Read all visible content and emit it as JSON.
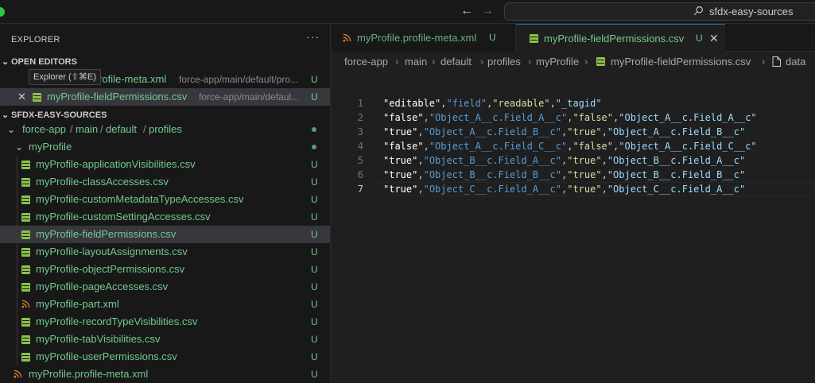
{
  "titlebar": {
    "back_icon": "arrow-left-icon",
    "forward_icon": "arrow-right-icon",
    "search_text": "sfdx-easy-sources"
  },
  "explorer": {
    "title": "EXPLORER",
    "more_icon": "···",
    "tooltip": "Explorer (⇧⌘E)",
    "open_editors": {
      "header": "OPEN EDITORS",
      "items": [
        {
          "name": "myProfile.profile-meta.xml",
          "path": "force-app/main/default/pro...",
          "status": "U",
          "icon": "rss-icon"
        },
        {
          "name": "myProfile-fieldPermissions.csv",
          "path": "force-app/main/defaul...",
          "status": "U",
          "icon": "csv-icon",
          "close": "✕"
        }
      ]
    },
    "workspace": {
      "header": "SFDX-EASY-SOURCES",
      "folder_path": [
        "force-app",
        "main",
        "default",
        "profiles"
      ],
      "path_sep": "/",
      "subfolder": "myProfile",
      "files": [
        {
          "name": "myProfile-applicationVisibilities.csv",
          "status": "U",
          "icon": "csv-icon"
        },
        {
          "name": "myProfile-classAccesses.csv",
          "status": "U",
          "icon": "csv-icon"
        },
        {
          "name": "myProfile-customMetadataTypeAccesses.csv",
          "status": "U",
          "icon": "csv-icon"
        },
        {
          "name": "myProfile-customSettingAccesses.csv",
          "status": "U",
          "icon": "csv-icon"
        },
        {
          "name": "myProfile-fieldPermissions.csv",
          "status": "U",
          "icon": "csv-icon"
        },
        {
          "name": "myProfile-layoutAssignments.csv",
          "status": "U",
          "icon": "csv-icon"
        },
        {
          "name": "myProfile-objectPermissions.csv",
          "status": "U",
          "icon": "csv-icon"
        },
        {
          "name": "myProfile-pageAccesses.csv",
          "status": "U",
          "icon": "csv-icon"
        },
        {
          "name": "myProfile-part.xml",
          "status": "U",
          "icon": "rss-icon"
        },
        {
          "name": "myProfile-recordTypeVisibilities.csv",
          "status": "U",
          "icon": "csv-icon"
        },
        {
          "name": "myProfile-tabVisibilities.csv",
          "status": "U",
          "icon": "csv-icon"
        },
        {
          "name": "myProfile-userPermissions.csv",
          "status": "U",
          "icon": "csv-icon"
        }
      ],
      "meta_file": {
        "name": "myProfile.profile-meta.xml",
        "status": "U",
        "icon": "rss-icon"
      }
    }
  },
  "tabs": [
    {
      "label": "myProfile.profile-meta.xml",
      "status": "U",
      "icon": "rss-icon"
    },
    {
      "label": "myProfile-fieldPermissions.csv",
      "status": "U",
      "icon": "csv-icon",
      "close": "✕"
    }
  ],
  "breadcrumbs": [
    "force-app",
    "main",
    "default",
    "profiles",
    "myProfile",
    "myProfile-fieldPermissions.csv",
    "data"
  ],
  "editor": {
    "line_numbers": [
      "1",
      "2",
      "3",
      "4",
      "5",
      "6",
      "7"
    ],
    "lines": [
      [
        "\"editable\"",
        ",",
        "\"field\"",
        ",",
        "\"readable\"",
        ",",
        "\"_tagid\""
      ],
      [
        "\"false\"",
        ",",
        "\"Object_A__c.Field_A__c\"",
        ",",
        "\"false\"",
        ",",
        "\"Object_A__c.Field_A__c\""
      ],
      [
        "\"true\"",
        ",",
        "\"Object_A__c.Field_B__c\"",
        ",",
        "\"true\"",
        ",",
        "\"Object_A__c.Field_B__c\""
      ],
      [
        "\"false\"",
        ",",
        "\"Object_A__c.Field_C__c\"",
        ",",
        "\"false\"",
        ",",
        "\"Object_A__c.Field_C__c\""
      ],
      [
        "\"true\"",
        ",",
        "\"Object_B__c.Field_A__c\"",
        ",",
        "\"true\"",
        ",",
        "\"Object_B__c.Field_A__c\""
      ],
      [
        "\"true\"",
        ",",
        "\"Object_B__c.Field_B__c\"",
        ",",
        "\"true\"",
        ",",
        "\"Object_B__c.Field_B__c\""
      ],
      [
        "\"true\"",
        ",",
        "\"Object_C__c.Field_A__c\"",
        ",",
        "\"true\"",
        ",",
        "\"Object_C__c.Field_A__c\""
      ]
    ],
    "column_colors": [
      "#ffffff",
      "#569cd6",
      "#dcdcaa",
      "#9cdcfe"
    ],
    "current_line": 7
  },
  "colors": {
    "accent": "#0078d4",
    "untracked": "#73c991",
    "csv_icon": "#8dc149",
    "xml_icon": "#e37933",
    "traffic_green": "#28c840"
  }
}
